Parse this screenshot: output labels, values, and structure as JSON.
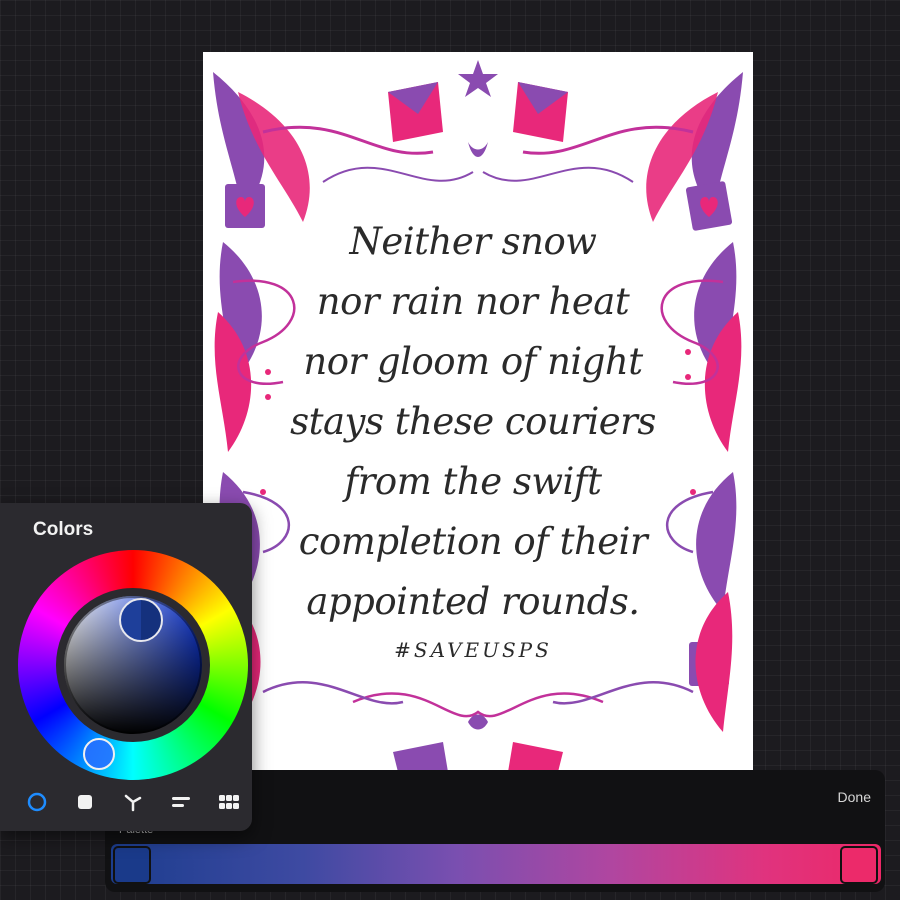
{
  "artwork": {
    "quote_lines": [
      "Neither snow",
      "nor rain nor heat",
      "nor gloom of night",
      "stays these couriers",
      "from the swift",
      "completion of their",
      "appointed rounds."
    ],
    "hashtag": "#SAVEUSPS",
    "colors": {
      "pink": "#e8287a",
      "purple": "#8a4bb0",
      "magenta": "#c2319a"
    }
  },
  "colors_panel": {
    "title": "Colors",
    "current_color": "#1e3f9a",
    "tabs": [
      {
        "name": "disc-tab",
        "icon": "disc-icon",
        "active": true
      },
      {
        "name": "classic-tab",
        "icon": "square-icon",
        "active": false
      },
      {
        "name": "harmony-tab",
        "icon": "harmony-icon",
        "active": false
      },
      {
        "name": "value-tab",
        "icon": "sliders-icon",
        "active": false
      },
      {
        "name": "palettes-tab",
        "icon": "grid-icon",
        "active": false
      }
    ],
    "accent": "#1e8cff"
  },
  "palette_bar": {
    "done_label": "Done",
    "palette_label": "Palette",
    "gradient_start": "#1c3d8e",
    "gradient_end": "#ec2867"
  }
}
